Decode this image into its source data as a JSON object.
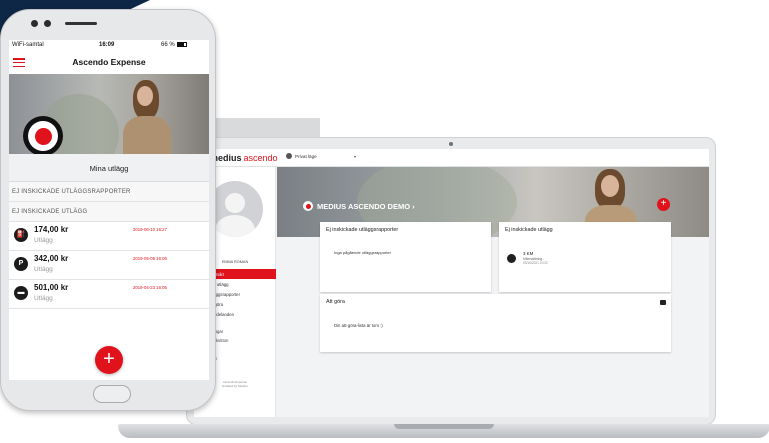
{
  "phone": {
    "status": {
      "carrier": "WiFi-samtal",
      "time": "16:09",
      "battery": "66 %"
    },
    "app_title": "Ascendo Expense",
    "subheader": "Mina utlägg",
    "section_reports": "EJ INSKICKADE UTLÄGGSRAPPORTER",
    "section_expenses": "EJ INSKICKADE UTLÄGG",
    "expenses": [
      {
        "icon": "fuel-icon",
        "amount": "174,00 kr",
        "type": "Utlägg",
        "date": "2019-06-10 16:27"
      },
      {
        "icon": "parking-icon",
        "amount": "342,00 kr",
        "type": "Utlägg",
        "date": "2019-05-09 16:06"
      },
      {
        "icon": "hotel-icon",
        "amount": "501,00 kr",
        "type": "Utlägg",
        "date": "2019-04-23 16:05"
      }
    ],
    "fab_label": "+",
    "p_glyph": "P"
  },
  "web": {
    "logo_a": "medius",
    "logo_b": "ascendo",
    "mode": "Privat läge",
    "mode_caret": "▾",
    "user_name": "EMMA ROMAN",
    "nav": [
      {
        "label": "Översikt",
        "icon": "overview-icon",
        "active": true
      },
      {
        "label": "Nytt utlägg",
        "icon": "plus-circle-icon",
        "active": false
      },
      {
        "label": "Utläggsrapporter",
        "icon": "folder-icon",
        "active": false
      },
      {
        "label": "Att göra",
        "icon": "checklist-icon",
        "active": false
      },
      {
        "label": "Meddelanden",
        "icon": "mail-icon",
        "active": false
      }
    ],
    "links": [
      "Inställningar",
      "Maila in kvitton",
      "Support",
      "Logga ut"
    ],
    "footer_a": "Ascendo Expense",
    "footer_b": "Enabled by Medius",
    "hero_title": "MEDIUS ASCENDO DEMO ›",
    "hero_fab": "+",
    "card_reports": {
      "title": "Ej inskickade utläggsrapporter",
      "empty": "Inga pågående utläggsrapporter"
    },
    "card_expenses": {
      "title": "Ej inskickade utlägg",
      "item_title": "3 KM",
      "item_sub": "Milersättning -",
      "item_date": "03/16/2021 10:22"
    },
    "card_todo": {
      "title": "Att göra",
      "empty": "Din att-göra-lista är tom :)"
    }
  },
  "colors": {
    "accent": "#e0131d",
    "navy": "#0f2746"
  }
}
